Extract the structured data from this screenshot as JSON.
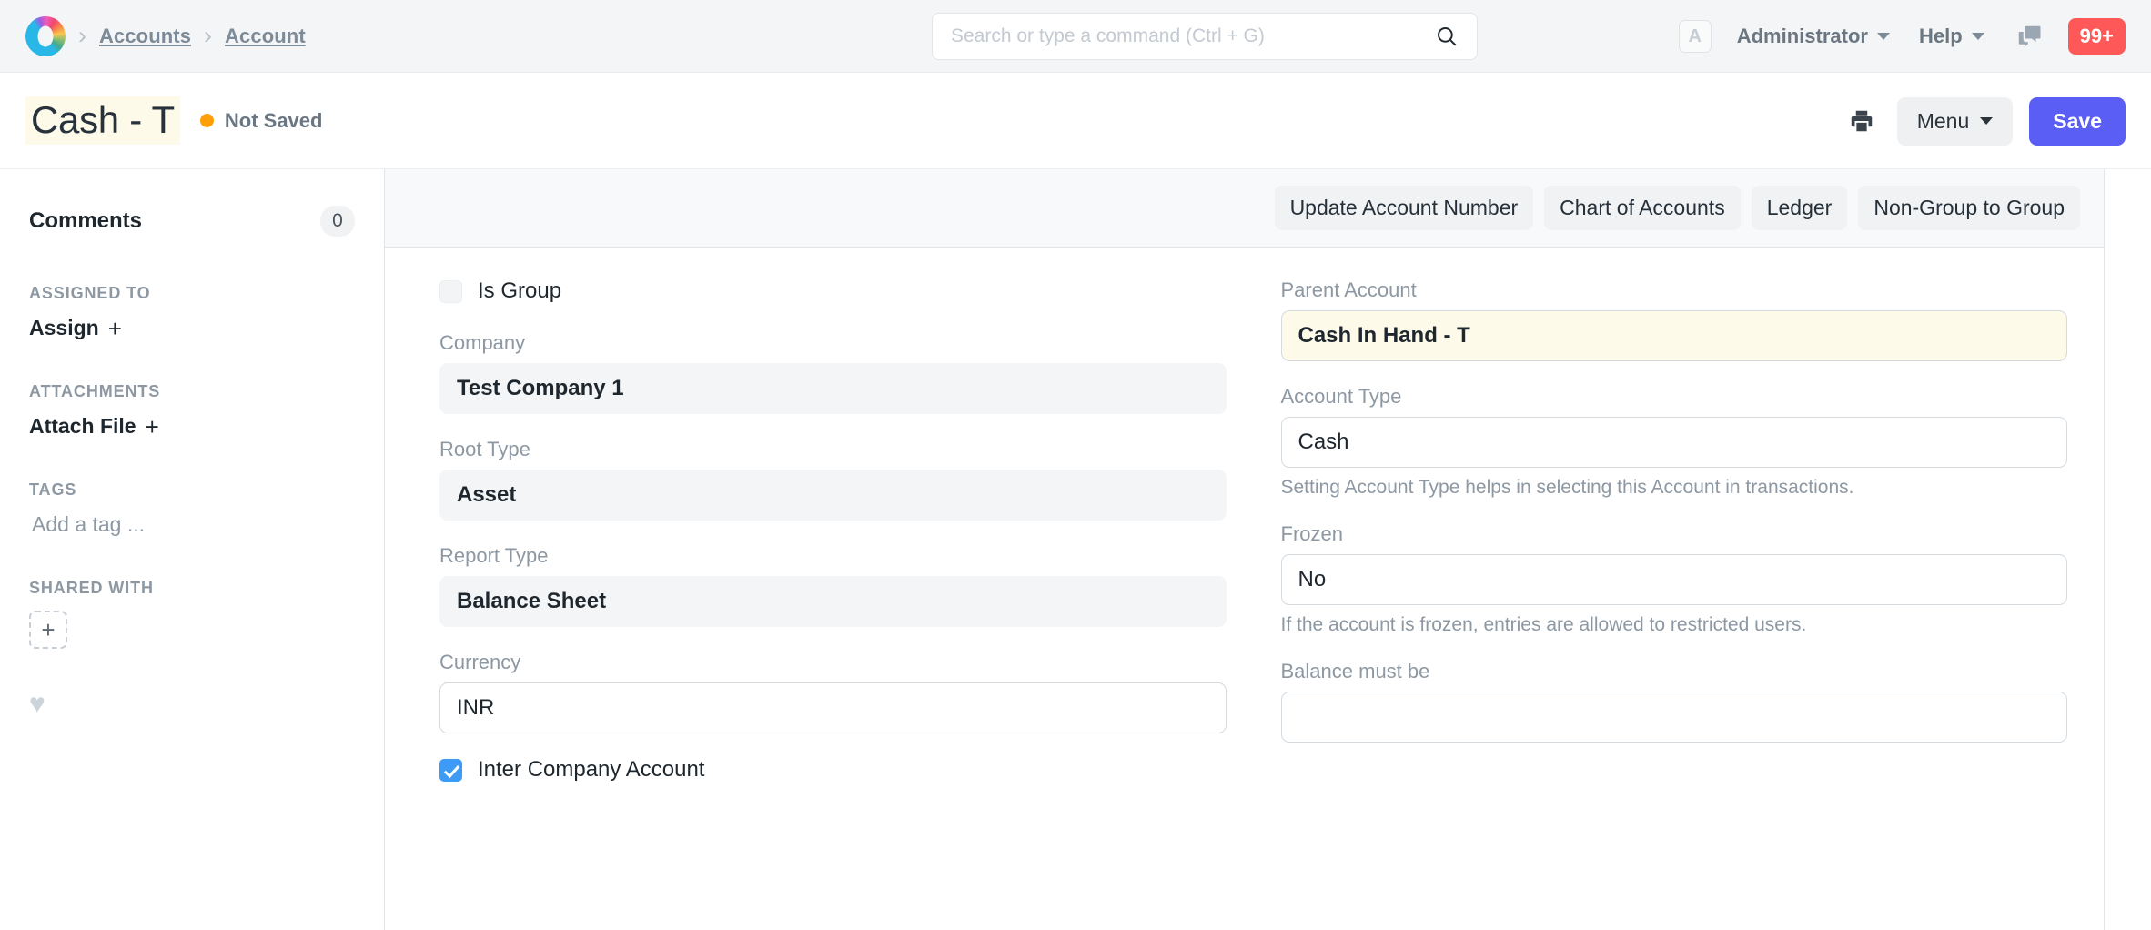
{
  "navbar": {
    "logo_icon": "frappe-logo-icon",
    "breadcrumbs": [
      {
        "label": "Accounts"
      },
      {
        "label": "Account"
      }
    ],
    "search": {
      "placeholder": "Search or type a command (Ctrl + G)",
      "value": "",
      "icon": "search-icon"
    },
    "avatar_initial": "A",
    "user_menu_label": "Administrator",
    "help_menu_label": "Help",
    "chat_icon": "chat-bubbles-icon",
    "notification_badge": "99+",
    "notification_badge_color": "#ff5858"
  },
  "page_head": {
    "title": "Cash - T",
    "title_highlight_color": "#fdfaea",
    "status_label": "Not Saved",
    "status_color": "#ffa00a",
    "print_icon": "printer-icon",
    "menu_label": "Menu",
    "save_label": "Save",
    "save_color": "#5a5ef5"
  },
  "sidebar": {
    "comments_label": "Comments",
    "comments_count": "0",
    "assigned_to_heading": "ASSIGNED TO",
    "assign_label": "Assign",
    "assign_plus": "+",
    "attachments_heading": "ATTACHMENTS",
    "attach_label": "Attach File",
    "attach_plus": "+",
    "tags_heading": "TAGS",
    "tag_placeholder": "Add a tag ...",
    "shared_with_heading": "SHARED WITH",
    "share_add_plus": "+",
    "like_icon": "heart-icon",
    "like_glyph": "♥"
  },
  "toolbar_buttons": [
    {
      "label": "Update Account Number",
      "name": "update-account-number-button"
    },
    {
      "label": "Chart of Accounts",
      "name": "chart-of-accounts-button"
    },
    {
      "label": "Ledger",
      "name": "ledger-button"
    },
    {
      "label": "Non-Group to Group",
      "name": "non-group-to-group-button"
    }
  ],
  "form": {
    "left": {
      "is_group": {
        "label": "Is Group",
        "checked": false,
        "disabled": true
      },
      "company": {
        "label": "Company",
        "value": "Test Company 1",
        "state": "readonly"
      },
      "root_type": {
        "label": "Root Type",
        "value": "Asset",
        "state": "readonly"
      },
      "report_type": {
        "label": "Report Type",
        "value": "Balance Sheet",
        "state": "readonly"
      },
      "currency": {
        "label": "Currency",
        "value": "INR",
        "state": "input"
      },
      "inter_company_account": {
        "label": "Inter Company Account",
        "checked": true
      }
    },
    "right": {
      "parent_account": {
        "label": "Parent Account",
        "value": "Cash In Hand - T",
        "state": "changed",
        "highlight_color": "#fdfaea"
      },
      "account_type": {
        "label": "Account Type",
        "value": "Cash",
        "state": "input",
        "help": "Setting Account Type helps in selecting this Account in transactions."
      },
      "frozen": {
        "label": "Frozen",
        "value": "No",
        "state": "input",
        "help": "If the account is frozen, entries are allowed to restricted users."
      },
      "balance_must_be": {
        "label": "Balance must be",
        "value": "",
        "state": "input"
      }
    }
  }
}
